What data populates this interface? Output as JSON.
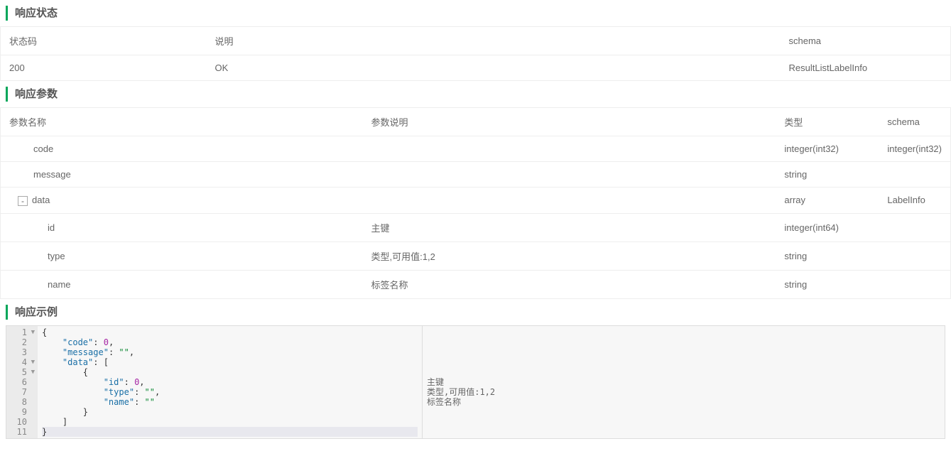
{
  "sections": {
    "status_title": "响应状态",
    "params_title": "响应参数",
    "example_title": "响应示例"
  },
  "status_table": {
    "headers": {
      "code": "状态码",
      "desc": "说明",
      "schema": "schema"
    },
    "row": {
      "code": "200",
      "desc": "OK",
      "schema": "ResultListLabelInfo"
    }
  },
  "params_table": {
    "headers": {
      "name": "参数名称",
      "desc": "参数说明",
      "type": "类型",
      "schema": "schema"
    },
    "rows": {
      "code": {
        "name": "code",
        "desc": "",
        "type": "integer(int32)",
        "schema": "integer(int32)"
      },
      "message": {
        "name": "message",
        "desc": "",
        "type": "string",
        "schema": ""
      },
      "data": {
        "name": "data",
        "desc": "",
        "type": "array",
        "schema": "LabelInfo",
        "toggle": "-"
      },
      "id": {
        "name": "id",
        "desc": "主键",
        "type": "integer(int64)",
        "schema": ""
      },
      "type": {
        "name": "type",
        "desc": "类型,可用值:1,2",
        "type": "string",
        "schema": ""
      },
      "nm": {
        "name": "name",
        "desc": "标签名称",
        "type": "string",
        "schema": ""
      }
    }
  },
  "code_example": {
    "lines": [
      "1",
      "2",
      "3",
      "4",
      "5",
      "6",
      "7",
      "8",
      "9",
      "10",
      "11"
    ],
    "arrows": {
      "0": "▼",
      "3": "▼",
      "4": "▼"
    },
    "tok": {
      "l1": "{",
      "k_code": "\"code\"",
      "v_code": "0",
      "k_msg": "\"message\"",
      "v_msg": "\"\"",
      "k_data": "\"data\"",
      "br_open": "[",
      "obj_open": "{",
      "k_id": "\"id\"",
      "v_id": "0",
      "k_type": "\"type\"",
      "v_type": "\"\"",
      "k_name": "\"name\"",
      "v_name": "\"\"",
      "obj_close": "}",
      "br_close": "]",
      "l11": "}",
      "colon": ": ",
      "comma": ","
    },
    "right": {
      "r1": "主键",
      "r2": "类型,可用值:1,2",
      "r3": "标签名称"
    }
  }
}
